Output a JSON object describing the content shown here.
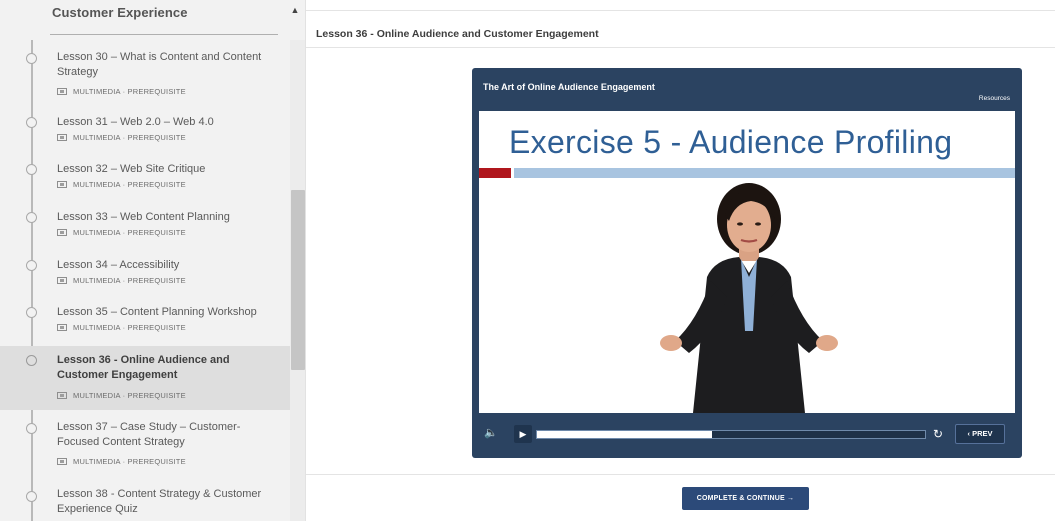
{
  "sidebar": {
    "section_title": "Customer Experience",
    "lessons": [
      {
        "title": "Lesson 30 – What is Content and Content Strategy",
        "meta": "MULTIMEDIA · PREREQUISITE"
      },
      {
        "title": "Lesson 31 – Web 2.0 – Web 4.0",
        "meta": "MULTIMEDIA · PREREQUISITE"
      },
      {
        "title": "Lesson 32 – Web Site Critique",
        "meta": "MULTIMEDIA · PREREQUISITE"
      },
      {
        "title": "Lesson 33 – Web Content Planning",
        "meta": "MULTIMEDIA · PREREQUISITE"
      },
      {
        "title": "Lesson 34 – Accessibility",
        "meta": "MULTIMEDIA · PREREQUISITE"
      },
      {
        "title": "Lesson 35 – Content Planning Workshop",
        "meta": "MULTIMEDIA · PREREQUISITE"
      },
      {
        "title": "Lesson 36 - Online Audience and Customer Engagement",
        "meta": "MULTIMEDIA · PREREQUISITE"
      },
      {
        "title": "Lesson 37 – Case Study – Customer-Focused Content Strategy",
        "meta": "MULTIMEDIA · PREREQUISITE"
      },
      {
        "title": "Lesson 38 - Content Strategy & Customer Experience Quiz",
        "meta": ""
      }
    ]
  },
  "main": {
    "title": "Lesson 36 - Online Audience and Customer Engagement",
    "player": {
      "title": "The Art of Online Audience Engagement",
      "resources_label": "Resources",
      "slide_heading": "Exercise 5 - Audience Profiling",
      "progress": 0.45,
      "prev_label": "‹ PREV"
    },
    "complete_button": "COMPLETE & CONTINUE →"
  },
  "colors": {
    "player_bg": "#2b4361",
    "heading_blue": "#2f5f95",
    "accent_red": "#b0161d",
    "accent_blue": "#a8c4e0",
    "button_bg": "#2c4a79"
  },
  "icons": [
    "chevron-up-icon",
    "media-icon",
    "volume-icon",
    "play-icon",
    "replay-icon"
  ]
}
